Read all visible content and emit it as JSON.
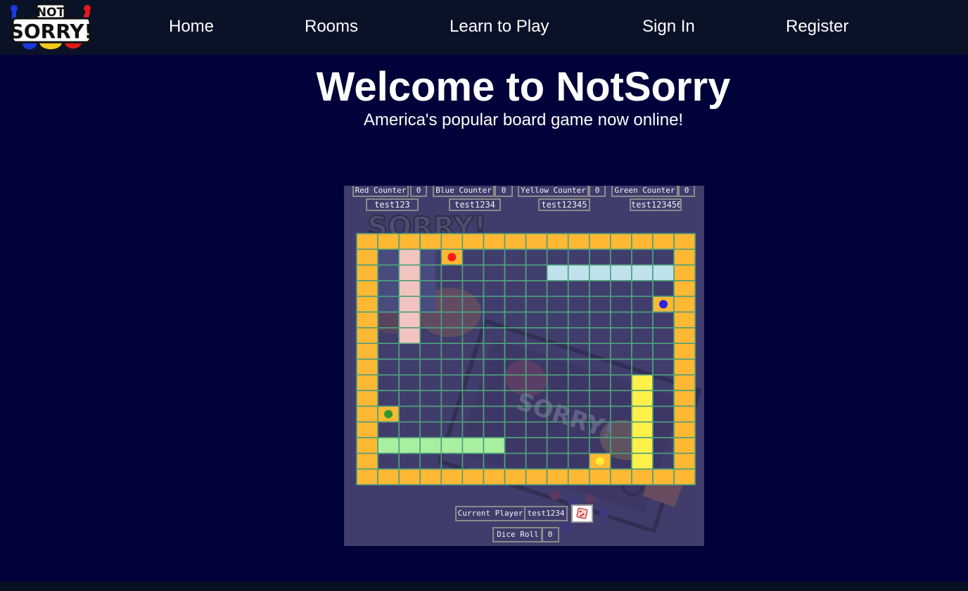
{
  "nav": {
    "logo_text_top": "NOT",
    "logo_text_bottom": "SORRY!",
    "links": [
      "Home",
      "Rooms",
      "Learn to Play",
      "Sign In",
      "Register"
    ]
  },
  "hero": {
    "title": "Welcome to NotSorry",
    "subtitle": "America's popular board game now online!"
  },
  "game": {
    "counters": [
      {
        "label": "Red Counter",
        "value": "0",
        "player": "test123"
      },
      {
        "label": "Blue Counter",
        "value": "0",
        "player": "test1234"
      },
      {
        "label": "Yellow Counter",
        "value": "0",
        "player": "test12345"
      },
      {
        "label": "Green Counter",
        "value": "0",
        "player": "test123456"
      }
    ],
    "current_player_label": "Current Player",
    "current_player": "test1234",
    "dice_roll_label": "Dice Roll",
    "dice_roll": "0",
    "board_bg_text": "SORRY!",
    "colors": {
      "track": "#ffb833",
      "grid_line": "#4f9e7c",
      "red_safety": "#f2c4c0",
      "blue_safety": "#bfe2ec",
      "yellow_safety": "#fff04a",
      "green_safety": "#a8f0a0",
      "red_pawn": "#ff1a1a",
      "blue_pawn": "#2626e0",
      "yellow_pawn": "#ffee33",
      "green_pawn": "#2a9a2a"
    }
  }
}
